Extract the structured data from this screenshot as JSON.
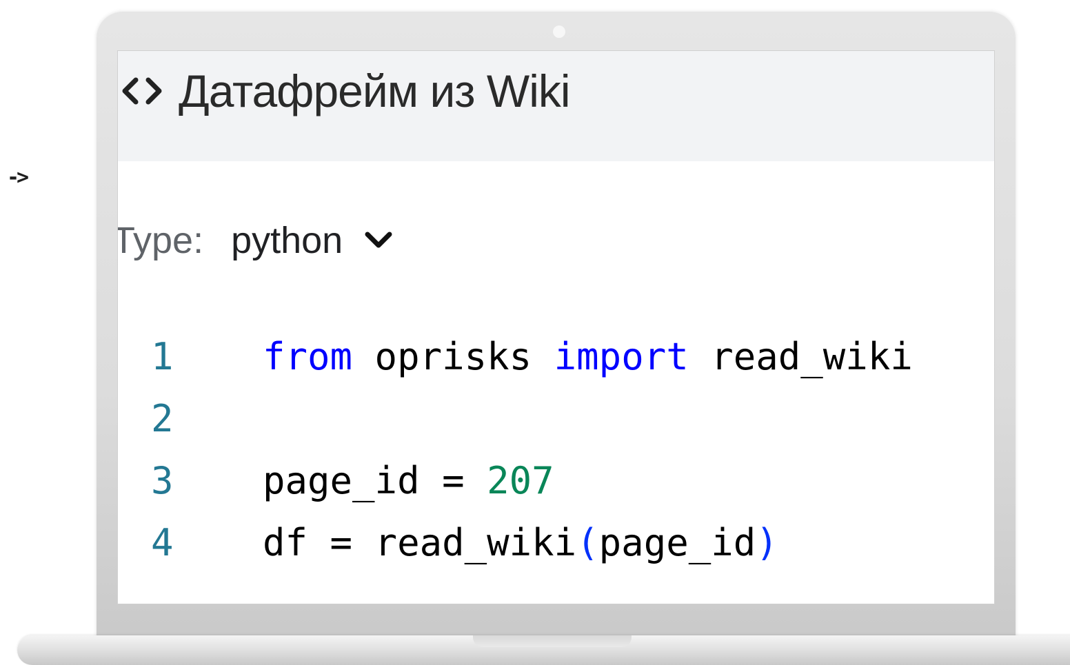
{
  "side_marker": "->",
  "title": "Датафрейм из Wiki",
  "type_selector": {
    "label": "Type:",
    "value": "python"
  },
  "code": {
    "lines": [
      {
        "number": "1",
        "tokens": [
          {
            "text": "from",
            "kind": "keyword"
          },
          {
            "text": " oprisks ",
            "kind": "plain"
          },
          {
            "text": "import",
            "kind": "keyword"
          },
          {
            "text": " read_wiki",
            "kind": "plain"
          }
        ]
      },
      {
        "number": "2",
        "tokens": []
      },
      {
        "number": "3",
        "tokens": [
          {
            "text": "page_id = ",
            "kind": "plain"
          },
          {
            "text": "207",
            "kind": "number"
          }
        ]
      },
      {
        "number": "4",
        "tokens": [
          {
            "text": "df = read_wiki",
            "kind": "plain"
          },
          {
            "text": "(",
            "kind": "paren"
          },
          {
            "text": "page_id",
            "kind": "plain"
          },
          {
            "text": ")",
            "kind": "paren"
          }
        ]
      }
    ]
  },
  "colors": {
    "keyword": "#0000ff",
    "number": "#098658",
    "line_number": "#237893",
    "paren": "#0431fa"
  },
  "icons": {
    "title_icon": "code-brackets-icon",
    "select_icon": "chevron-down-icon"
  }
}
